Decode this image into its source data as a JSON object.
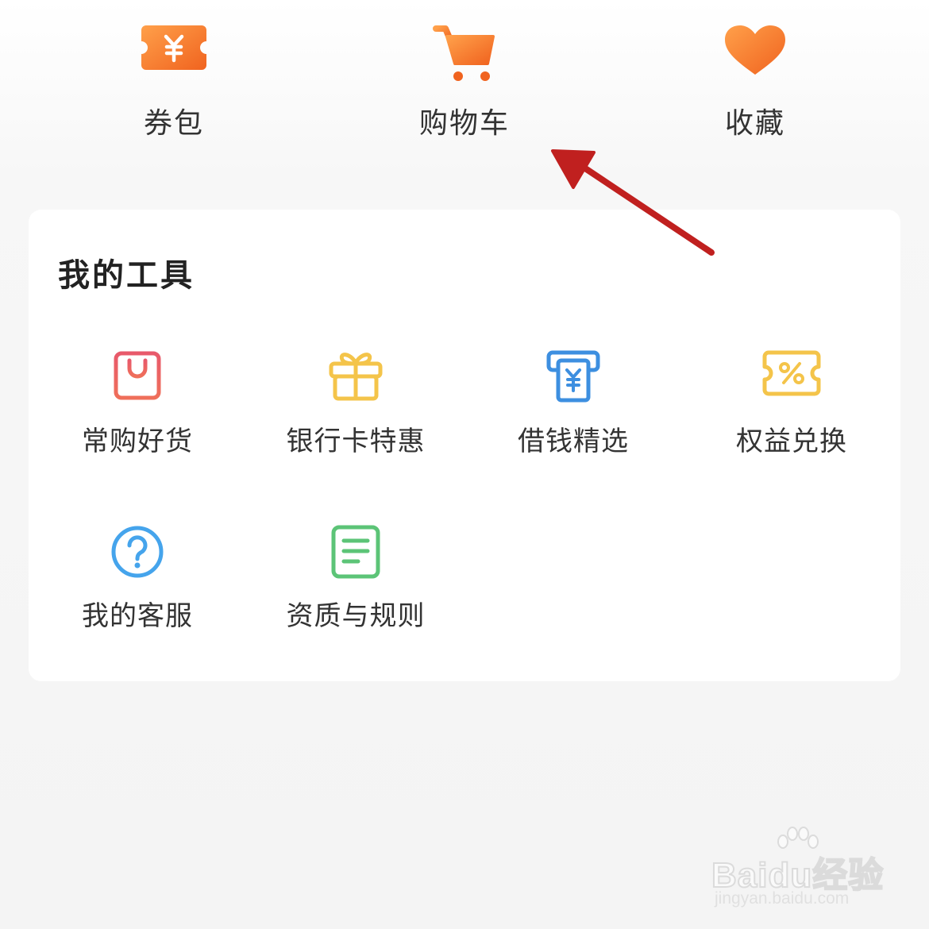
{
  "top_nav": {
    "items": [
      {
        "label": "券包",
        "icon": "coupon-ticket-icon"
      },
      {
        "label": "购物车",
        "icon": "shopping-cart-icon"
      },
      {
        "label": "收藏",
        "icon": "heart-icon"
      }
    ]
  },
  "tools": {
    "title": "我的工具",
    "items": [
      {
        "label": "常购好货",
        "icon": "shopping-bag-icon"
      },
      {
        "label": "银行卡特惠",
        "icon": "gift-icon"
      },
      {
        "label": "借钱精选",
        "icon": "atm-yuan-icon"
      },
      {
        "label": "权益兑换",
        "icon": "discount-coupon-icon"
      },
      {
        "label": "我的客服",
        "icon": "help-question-icon"
      },
      {
        "label": "资质与规则",
        "icon": "document-icon"
      }
    ]
  },
  "annotation": {
    "icon": "red-arrow-icon",
    "color": "#c0201f"
  },
  "watermark": {
    "brand": "Baidu经验",
    "url": "jingyan.baidu.com"
  },
  "colors": {
    "accent_orange": "#f47a2a",
    "tool_red": "#e8596b",
    "tool_yellow": "#f4c44a",
    "tool_blue": "#3d8fe0",
    "tool_sky": "#45a4ec",
    "tool_green": "#5cc477"
  }
}
